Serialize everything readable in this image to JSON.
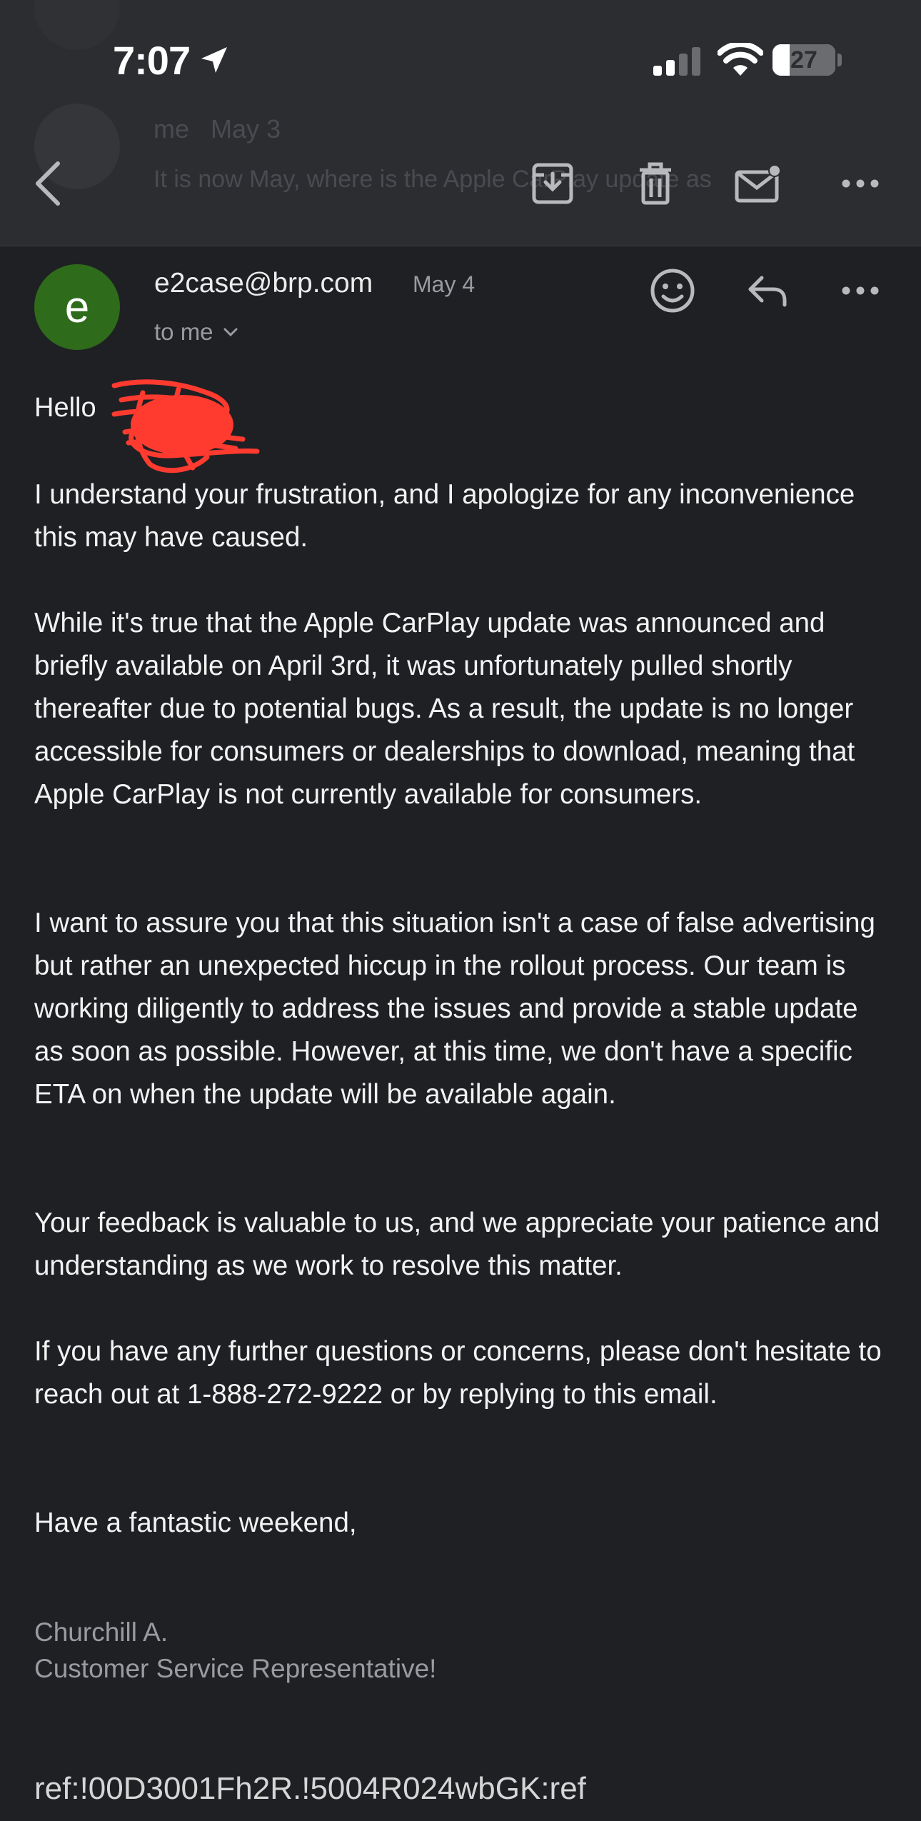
{
  "status_bar": {
    "time": "7:07",
    "battery": "27",
    "battery_level": 0.27
  },
  "toolbar": {
    "back": "back",
    "archive": "archive",
    "delete": "delete",
    "mark_unread": "mark-unread",
    "more": "more"
  },
  "background_thread": {
    "sender": "me",
    "date": "May 3",
    "preview": "It is now May, where is the Apple CarPlay update as"
  },
  "message": {
    "avatar_letter": "e",
    "avatar_color": "#2e6b1a",
    "sender": "e2case@brp.com",
    "date": "May 4",
    "recipient": "to me",
    "greeting": "Hello",
    "paragraphs": [
      "I understand your frustration, and I apologize for any inconvenience this may have caused.",
      "While it's true that the Apple CarPlay update was announced and briefly available on April 3rd, it was unfortunately pulled shortly thereafter due to potential bugs. As a result, the update is no longer accessible for consumers or dealerships to download, meaning that Apple CarPlay is not currently available for consumers.",
      "I want to assure you that this situation isn't a case of false advertising but rather an unexpected hiccup in the rollout process. Our team is working diligently to address the issues and provide a stable update as soon as possible. However, at this time, we don't have a specific ETA on when the update will be available again.",
      "Your feedback is valuable to us, and we appreciate your patience and understanding as we work to resolve this matter.",
      "If you have any further questions or concerns, please don't hesitate to reach out at 1-888-272-9222 or by replying to this email.",
      "Have a fantastic weekend,"
    ],
    "signature_name": "Churchill A.",
    "signature_title": "Customer Service Representative!",
    "ref": "ref:!00D3001Fh2R.!5004R024wbGK:ref"
  },
  "colors": {
    "background": "#1f2024",
    "header": "#2c2d31",
    "redaction": "#ff3b30"
  }
}
